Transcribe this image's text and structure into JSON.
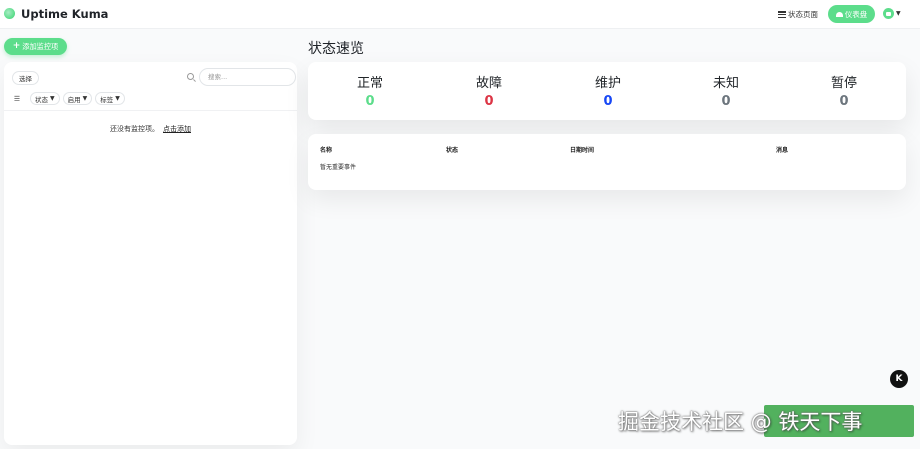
{
  "header": {
    "app_title": "Uptime Kuma",
    "status_page_label": "状态页面",
    "dashboard_label": "仪表盘"
  },
  "sidebar": {
    "add_monitor_label": "添加监控项",
    "select_label": "选择",
    "search_placeholder": "搜索...",
    "filters": [
      {
        "label": "状态"
      },
      {
        "label": "启用"
      },
      {
        "label": "标签"
      }
    ],
    "empty_message": "还没有监控项。",
    "empty_link": "点击添加"
  },
  "main": {
    "page_title": "状态速览",
    "stats": [
      {
        "label": "正常",
        "value": "0",
        "color": "#5cdd8b"
      },
      {
        "label": "故障",
        "value": "0",
        "color": "#dc3545"
      },
      {
        "label": "维护",
        "value": "0",
        "color": "#1747f5"
      },
      {
        "label": "未知",
        "value": "0",
        "color": "#6c757d"
      },
      {
        "label": "暂停",
        "value": "0",
        "color": "#6c757d"
      }
    ],
    "events_table": {
      "columns": [
        "名称",
        "状态",
        "日期时间",
        "消息"
      ],
      "empty_text": "暂无重要事件"
    }
  },
  "watermark": {
    "text": "掘金技术社区 @ 铁天下事",
    "badge": "K"
  }
}
